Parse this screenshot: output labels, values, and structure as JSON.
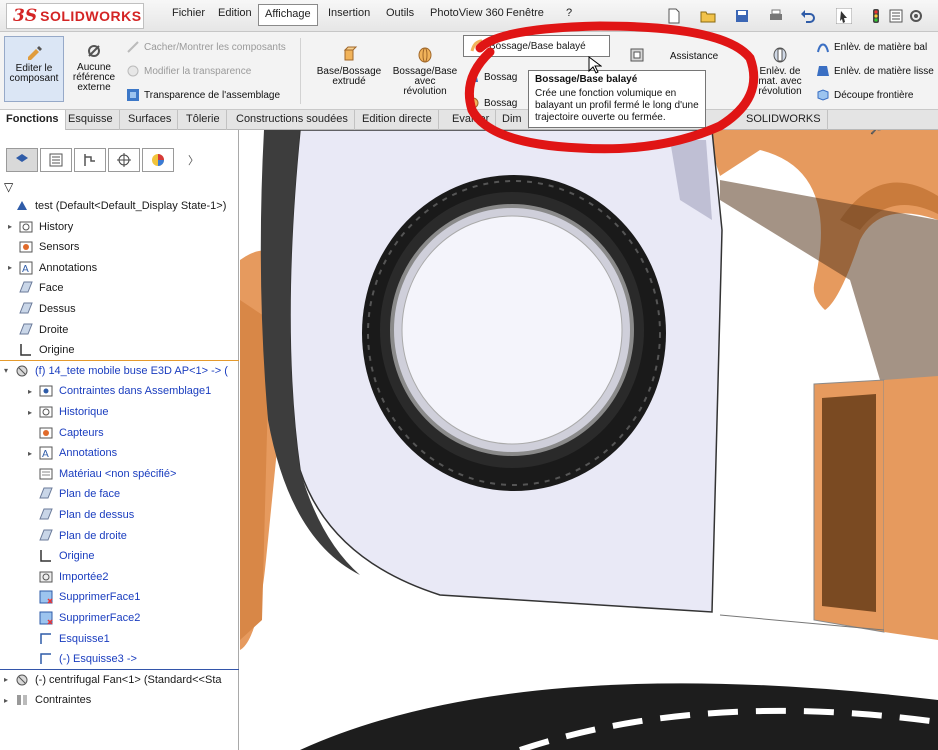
{
  "app": {
    "brand_ds": "3S",
    "brand_name": "SOLIDWORKS"
  },
  "menus": [
    "Fichier",
    "Edition",
    "Affichage",
    "Insertion",
    "Outils",
    "PhotoView 360",
    "Fenêtre",
    "?"
  ],
  "ribbon": {
    "edit_component": "Editer le composant",
    "no_reference": "Aucune référence externe",
    "hide_show": "Cacher/Montrer les composants",
    "modify_transparency": "Modifier la transparence",
    "assembly_transparency": "Transparence de l'assemblage",
    "extruded_boss": "Base/Bossage extrudé",
    "revolved_boss": "Bossage/Base avec révolution",
    "swept_boss": "Bossage/Base balayé",
    "boss2": "Bossag",
    "boss3": "Bossag",
    "assistance": "Assistance",
    "revolved_cut": "Enlèv. de mat. avec révolution",
    "cut1": "Enlèv. de matière bal",
    "cut2": "Enlèv. de matière lisse",
    "boundary_cut": "Découpe frontière"
  },
  "tooltip": {
    "header": "Bossage/Base balayé",
    "title": "Bossage/Base balayé",
    "body": "Crée une fonction volumique en balayant un profil fermé le long d'une trajectoire ouverte ou fermée."
  },
  "tabs": [
    "Fonctions",
    "Esquisse",
    "Surfaces",
    "Tôlerie",
    "Constructions soudées",
    "Edition directe",
    "Evaluer",
    "Dim",
    "SOLIDWORKS"
  ],
  "tree": {
    "root": "test (Default<Default_Display State-1>)",
    "items": [
      "History",
      "Sensors",
      "Annotations",
      "Face",
      "Dessus",
      "Droite",
      "Origine"
    ],
    "part": "(f) 14_tete mobile buse E3D AP<1> -> (",
    "part_items": [
      "Contraintes dans Assemblage1",
      "Historique",
      "Capteurs",
      "Annotations",
      "Matériau <non spécifié>",
      "Plan de face",
      "Plan de dessus",
      "Plan de droite",
      "Origine",
      "Importée2",
      "SupprimerFace1",
      "SupprimerFace2",
      "Esquisse1",
      "(-) Esquisse3 ->"
    ],
    "fan": "(-) centrifugal Fan<1> (Standard<<Sta",
    "constraints": "Contraintes"
  },
  "colors": {
    "accent_red": "#d42424",
    "part_orange": "#e69a5e",
    "fan_face": "#e9e9f6",
    "highlight_circle": "#e01515"
  }
}
